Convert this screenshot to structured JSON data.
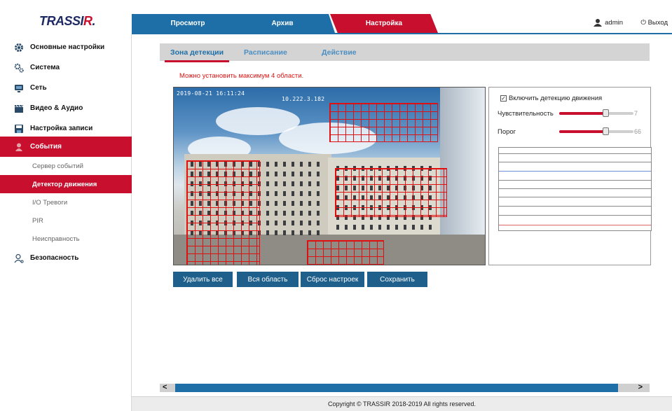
{
  "brand": {
    "logo_main": "TRASSI",
    "logo_accent": "R",
    "logo_dot": "."
  },
  "topbar": {
    "tabs": [
      "Просмотр",
      "Архив",
      "Настройка"
    ],
    "user": "admin",
    "logout": "Выход"
  },
  "sidebar": {
    "items": [
      {
        "label": "Основные настройки",
        "icon": "gear-icon"
      },
      {
        "label": "Система",
        "icon": "gears-icon"
      },
      {
        "label": "Сеть",
        "icon": "network-icon"
      },
      {
        "label": "Видео & Аудио",
        "icon": "clapper-icon"
      },
      {
        "label": "Настройка записи",
        "icon": "floppy-icon"
      },
      {
        "label": "События",
        "icon": "user-event-icon"
      },
      {
        "label": "Безопасность",
        "icon": "security-user-icon"
      }
    ],
    "subitems": [
      "Сервер событий",
      "Детектор движения",
      "I/O Тревоги",
      "PIR",
      "Неисправность"
    ]
  },
  "subtabs": [
    "Зона детекции",
    "Расписание",
    "Действие"
  ],
  "warning": "Можно установить максимум 4 области.",
  "video": {
    "osd_timestamp": "2019-08-21 16:11:24",
    "osd_camera": "10.222.3.182"
  },
  "settings": {
    "enable_label": "Включить детекцию движения",
    "enabled": true,
    "sensitivity_label": "Чувствительность",
    "sensitivity_value": "7",
    "sensitivity_fraction": 0.62,
    "threshold_label": "Порог",
    "threshold_value": "66",
    "threshold_fraction": 0.62
  },
  "buttons": [
    "Удалить все",
    "Вся область",
    "Сброс настроек",
    "Сохранить"
  ],
  "footer": "Copyright © TRASSIR 2018-2019 All rights reserved.",
  "colors": {
    "brand_red": "#c8102e",
    "brand_blue": "#1e6fa8"
  }
}
